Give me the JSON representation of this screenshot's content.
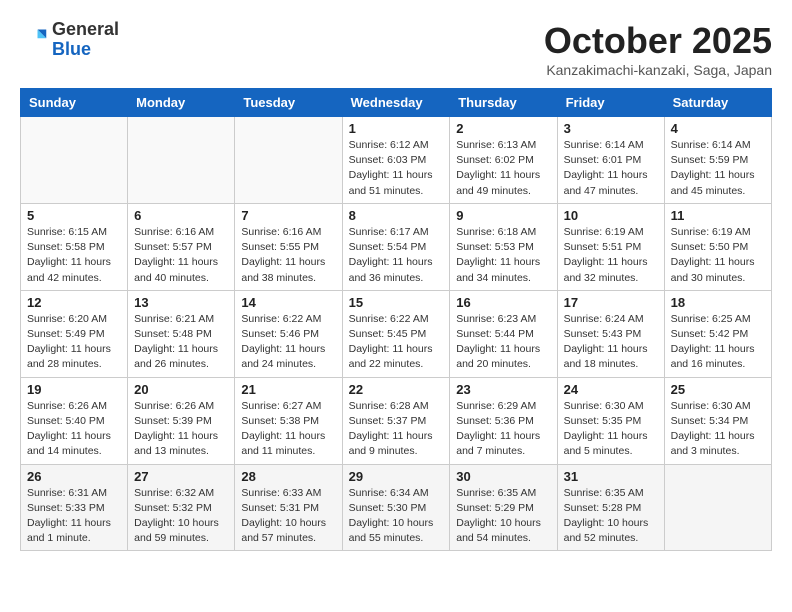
{
  "header": {
    "logo_general": "General",
    "logo_blue": "Blue",
    "title": "October 2025",
    "subtitle": "Kanzakimachi-kanzaki, Saga, Japan"
  },
  "days_of_week": [
    "Sunday",
    "Monday",
    "Tuesday",
    "Wednesday",
    "Thursday",
    "Friday",
    "Saturday"
  ],
  "weeks": [
    [
      {
        "day": "",
        "info": ""
      },
      {
        "day": "",
        "info": ""
      },
      {
        "day": "",
        "info": ""
      },
      {
        "day": "1",
        "info": "Sunrise: 6:12 AM\nSunset: 6:03 PM\nDaylight: 11 hours\nand 51 minutes."
      },
      {
        "day": "2",
        "info": "Sunrise: 6:13 AM\nSunset: 6:02 PM\nDaylight: 11 hours\nand 49 minutes."
      },
      {
        "day": "3",
        "info": "Sunrise: 6:14 AM\nSunset: 6:01 PM\nDaylight: 11 hours\nand 47 minutes."
      },
      {
        "day": "4",
        "info": "Sunrise: 6:14 AM\nSunset: 5:59 PM\nDaylight: 11 hours\nand 45 minutes."
      }
    ],
    [
      {
        "day": "5",
        "info": "Sunrise: 6:15 AM\nSunset: 5:58 PM\nDaylight: 11 hours\nand 42 minutes."
      },
      {
        "day": "6",
        "info": "Sunrise: 6:16 AM\nSunset: 5:57 PM\nDaylight: 11 hours\nand 40 minutes."
      },
      {
        "day": "7",
        "info": "Sunrise: 6:16 AM\nSunset: 5:55 PM\nDaylight: 11 hours\nand 38 minutes."
      },
      {
        "day": "8",
        "info": "Sunrise: 6:17 AM\nSunset: 5:54 PM\nDaylight: 11 hours\nand 36 minutes."
      },
      {
        "day": "9",
        "info": "Sunrise: 6:18 AM\nSunset: 5:53 PM\nDaylight: 11 hours\nand 34 minutes."
      },
      {
        "day": "10",
        "info": "Sunrise: 6:19 AM\nSunset: 5:51 PM\nDaylight: 11 hours\nand 32 minutes."
      },
      {
        "day": "11",
        "info": "Sunrise: 6:19 AM\nSunset: 5:50 PM\nDaylight: 11 hours\nand 30 minutes."
      }
    ],
    [
      {
        "day": "12",
        "info": "Sunrise: 6:20 AM\nSunset: 5:49 PM\nDaylight: 11 hours\nand 28 minutes."
      },
      {
        "day": "13",
        "info": "Sunrise: 6:21 AM\nSunset: 5:48 PM\nDaylight: 11 hours\nand 26 minutes."
      },
      {
        "day": "14",
        "info": "Sunrise: 6:22 AM\nSunset: 5:46 PM\nDaylight: 11 hours\nand 24 minutes."
      },
      {
        "day": "15",
        "info": "Sunrise: 6:22 AM\nSunset: 5:45 PM\nDaylight: 11 hours\nand 22 minutes."
      },
      {
        "day": "16",
        "info": "Sunrise: 6:23 AM\nSunset: 5:44 PM\nDaylight: 11 hours\nand 20 minutes."
      },
      {
        "day": "17",
        "info": "Sunrise: 6:24 AM\nSunset: 5:43 PM\nDaylight: 11 hours\nand 18 minutes."
      },
      {
        "day": "18",
        "info": "Sunrise: 6:25 AM\nSunset: 5:42 PM\nDaylight: 11 hours\nand 16 minutes."
      }
    ],
    [
      {
        "day": "19",
        "info": "Sunrise: 6:26 AM\nSunset: 5:40 PM\nDaylight: 11 hours\nand 14 minutes."
      },
      {
        "day": "20",
        "info": "Sunrise: 6:26 AM\nSunset: 5:39 PM\nDaylight: 11 hours\nand 13 minutes."
      },
      {
        "day": "21",
        "info": "Sunrise: 6:27 AM\nSunset: 5:38 PM\nDaylight: 11 hours\nand 11 minutes."
      },
      {
        "day": "22",
        "info": "Sunrise: 6:28 AM\nSunset: 5:37 PM\nDaylight: 11 hours\nand 9 minutes."
      },
      {
        "day": "23",
        "info": "Sunrise: 6:29 AM\nSunset: 5:36 PM\nDaylight: 11 hours\nand 7 minutes."
      },
      {
        "day": "24",
        "info": "Sunrise: 6:30 AM\nSunset: 5:35 PM\nDaylight: 11 hours\nand 5 minutes."
      },
      {
        "day": "25",
        "info": "Sunrise: 6:30 AM\nSunset: 5:34 PM\nDaylight: 11 hours\nand 3 minutes."
      }
    ],
    [
      {
        "day": "26",
        "info": "Sunrise: 6:31 AM\nSunset: 5:33 PM\nDaylight: 11 hours\nand 1 minute."
      },
      {
        "day": "27",
        "info": "Sunrise: 6:32 AM\nSunset: 5:32 PM\nDaylight: 10 hours\nand 59 minutes."
      },
      {
        "day": "28",
        "info": "Sunrise: 6:33 AM\nSunset: 5:31 PM\nDaylight: 10 hours\nand 57 minutes."
      },
      {
        "day": "29",
        "info": "Sunrise: 6:34 AM\nSunset: 5:30 PM\nDaylight: 10 hours\nand 55 minutes."
      },
      {
        "day": "30",
        "info": "Sunrise: 6:35 AM\nSunset: 5:29 PM\nDaylight: 10 hours\nand 54 minutes."
      },
      {
        "day": "31",
        "info": "Sunrise: 6:35 AM\nSunset: 5:28 PM\nDaylight: 10 hours\nand 52 minutes."
      },
      {
        "day": "",
        "info": ""
      }
    ]
  ]
}
